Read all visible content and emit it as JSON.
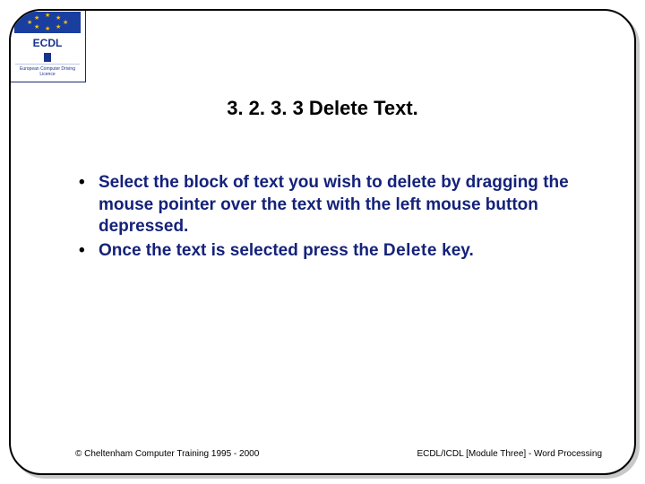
{
  "logo": {
    "label": "ECDL",
    "subtext": "European Computer Driving Licence"
  },
  "title": "3. 2. 3. 3 Delete Text.",
  "bullets": [
    {
      "text": "Select the block of text you wish to delete by dragging the mouse pointer over the text with the left mouse button depressed."
    },
    {
      "prefix": "Once the text is selected press the ",
      "strong": "Delete",
      "suffix": " key."
    }
  ],
  "footer": {
    "left": "© Cheltenham Computer Training 1995 - 2000",
    "right": "ECDL/ICDL [Module Three]  - Word Processing"
  }
}
